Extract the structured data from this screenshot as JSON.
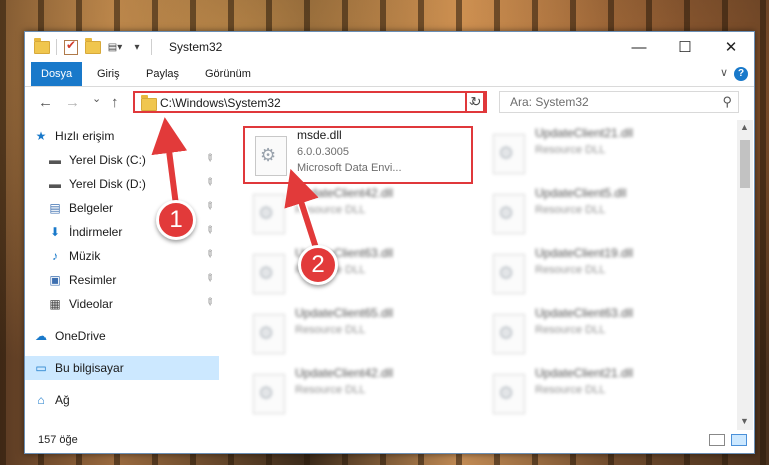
{
  "window": {
    "title": "System32",
    "controls": [
      "—",
      "☐",
      "✕"
    ]
  },
  "ribbon": {
    "tabs": [
      "Dosya",
      "Giriş",
      "Paylaş",
      "Görünüm"
    ],
    "help": "?",
    "expand": "∨"
  },
  "navigation": {
    "back": "←",
    "forward": "→",
    "recent": "⌄",
    "up": "↑",
    "address": "C:\\Windows\\System32",
    "address_dropdown": "⌄",
    "refresh": "↻",
    "search_placeholder": "Ara: System32",
    "search_icon": "⚲"
  },
  "sidebar": {
    "items": [
      {
        "label": "Hızlı erişim",
        "icon": "star-icon",
        "glyph": "★",
        "color": "#1979ca",
        "pinned": false
      },
      {
        "label": "Yerel Disk (C:)",
        "icon": "drive-icon",
        "glyph": "▬",
        "color": "#555555",
        "pinned": true
      },
      {
        "label": "Yerel Disk (D:)",
        "icon": "drive-icon",
        "glyph": "▬",
        "color": "#555555",
        "pinned": true
      },
      {
        "label": "Belgeler",
        "icon": "documents-icon",
        "glyph": "▤",
        "color": "#3d6fb0",
        "pinned": true
      },
      {
        "label": "İndirmeler",
        "icon": "downloads-icon",
        "glyph": "⬇",
        "color": "#1979ca",
        "pinned": true
      },
      {
        "label": "Müzik",
        "icon": "music-icon",
        "glyph": "♪",
        "color": "#1979ca",
        "pinned": true
      },
      {
        "label": "Resimler",
        "icon": "pictures-icon",
        "glyph": "▣",
        "color": "#3d6fb0",
        "pinned": true
      },
      {
        "label": "Videolar",
        "icon": "videos-icon",
        "glyph": "▦",
        "color": "#444444",
        "pinned": true
      },
      {
        "label": "OneDrive",
        "icon": "cloud-icon",
        "glyph": "☁",
        "color": "#1979ca",
        "pinned": false
      },
      {
        "label": "Bu bilgisayar",
        "icon": "computer-icon",
        "glyph": "▭",
        "color": "#1979ca",
        "pinned": false,
        "selected": true
      },
      {
        "label": "Ağ",
        "icon": "network-icon",
        "glyph": "⌂",
        "color": "#1979ca",
        "pinned": false
      }
    ],
    "pin_glyph": "📌"
  },
  "files": [
    {
      "name": "msde.dll",
      "line1": "6.0.0.3005",
      "line2": "Microsoft Data Envi...",
      "highlight": true
    },
    {
      "name": "UpdateClient21.dll",
      "line1": "Resource DLL"
    },
    {
      "name": "UpdateClient42.dll",
      "line1": "Resource DLL"
    },
    {
      "name": "UpdateClient5.dll",
      "line1": "Resource DLL"
    },
    {
      "name": "UpdateClient63.dll",
      "line1": "Resource DLL"
    },
    {
      "name": "UpdateClient19.dll",
      "line1": "Resource DLL"
    },
    {
      "name": "UpdateClient65.dll",
      "line1": "Resource DLL"
    },
    {
      "name": "UpdateClient63.dll",
      "line1": "Resource DLL"
    },
    {
      "name": "UpdateClient42.dll",
      "line1": "Resource DLL"
    },
    {
      "name": "UpdateClient21.dll",
      "line1": "Resource DLL"
    }
  ],
  "status": {
    "count": "157 öğe"
  },
  "annotations": {
    "badge1": "1",
    "badge2": "2",
    "color": "#e23a3a"
  }
}
